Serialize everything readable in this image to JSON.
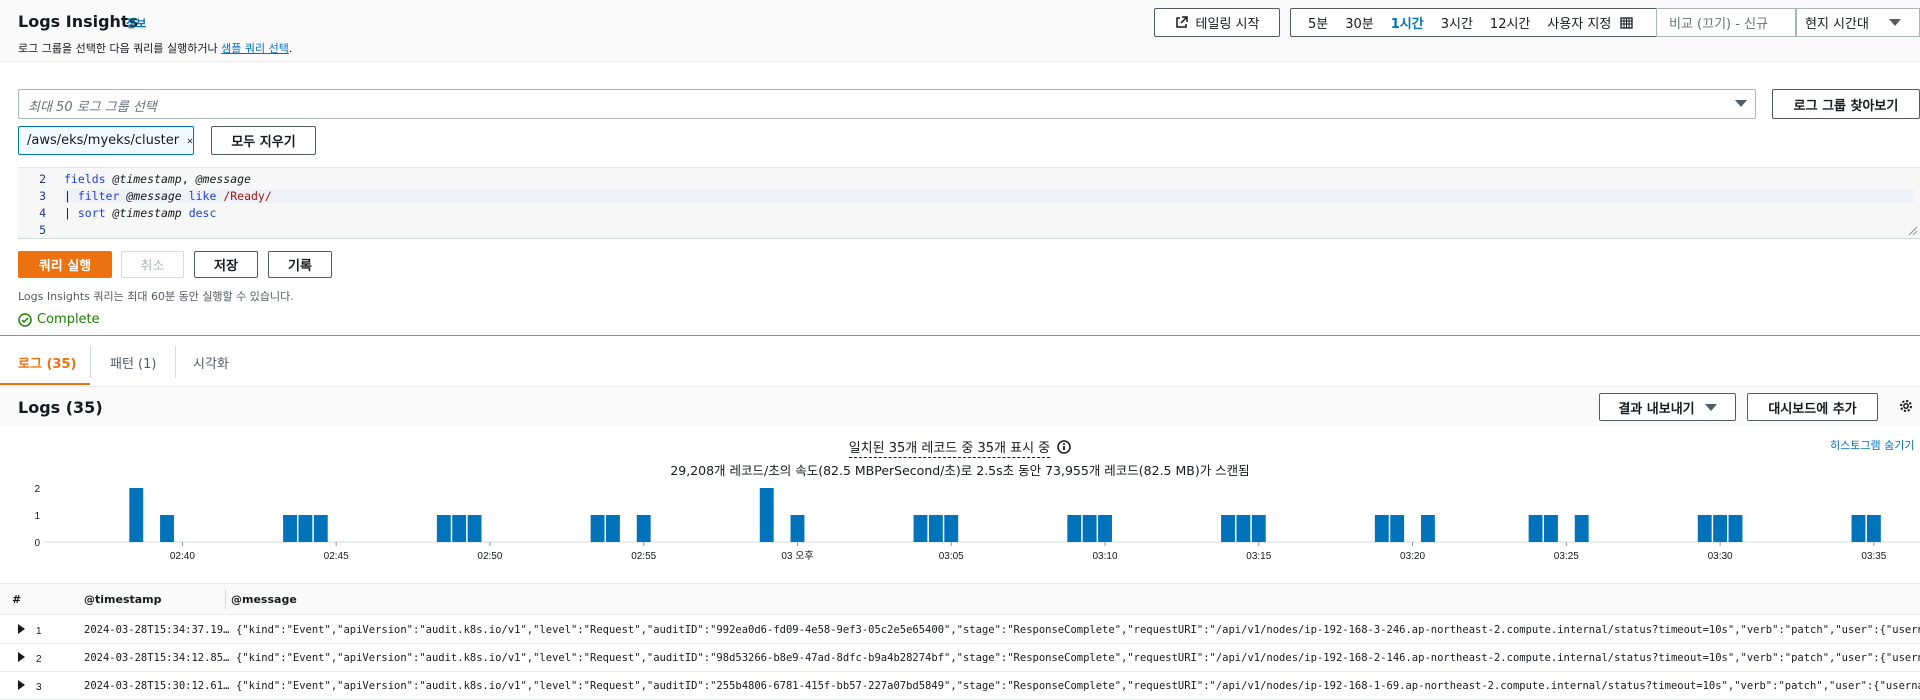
{
  "header": {
    "title": "Logs Insights",
    "info": "정보",
    "subtitle_prefix": "로그 그룹을 선택한 다음 쿼리를 실행하거나 ",
    "subtitle_link": "샘플 쿼리 선택",
    "subtitle_suffix": ".",
    "tail_button": "테일링 시작",
    "time_options": [
      "5분",
      "30분",
      "1시간",
      "3시간",
      "12시간",
      "사용자 지정"
    ],
    "selected_time": "1시간",
    "compare": "비교 (끄기) - 신규",
    "timezone": "현지 시간대"
  },
  "log_groups": {
    "placeholder": "최대 50 로그 그룹 선택",
    "browse_button": "로그 그룹 찾아보기",
    "token": "/aws/eks/myeks/cluster",
    "clear_button": "모두 지우기"
  },
  "editor": {
    "line_numbers": [
      "2",
      "3",
      "4",
      "5"
    ]
  },
  "actions": {
    "run": "쿼리 실행",
    "cancel": "취소",
    "save": "저장",
    "history": "기록",
    "note": "Logs Insights 쿼리는 최대 60분 동안 실행할 수 있습니다.",
    "status": "Complete"
  },
  "tabs": [
    "로그 (35)",
    "패턴 (1)",
    "시각화"
  ],
  "logs": {
    "title": "Logs (35)",
    "export_button": "결과 내보내기",
    "dashboard_button": "대시보드에 추가",
    "match_text": "일치된 35개 레코드 중 35개 표시 중",
    "scan_text": "29,208개 레코드/초의 속도(82.5 MBPerSecond/초)로 2.5s초 동안 73,955개 레코드(82.5 MB)가 스캔됨",
    "hide_histogram": "히스토그램 숨기기"
  },
  "chart_data": {
    "type": "bar",
    "y_ticks": [
      "0",
      "1",
      "2"
    ],
    "ylim": [
      0,
      2
    ],
    "x_ticks": [
      "02:40",
      "02:45",
      "02:50",
      "02:55",
      "03 오후",
      "03:05",
      "03:10",
      "03:15",
      "03:20",
      "03:25",
      "03:30",
      "03:35"
    ],
    "bars": [
      {
        "x": "02:38:30",
        "value": 2
      },
      {
        "x": "02:39:30",
        "value": 1
      },
      {
        "x": "02:43:30",
        "value": 1
      },
      {
        "x": "02:44:00",
        "value": 1
      },
      {
        "x": "02:44:30",
        "value": 1
      },
      {
        "x": "02:48:30",
        "value": 1
      },
      {
        "x": "02:49:00",
        "value": 1
      },
      {
        "x": "02:49:30",
        "value": 1
      },
      {
        "x": "02:53:30",
        "value": 1
      },
      {
        "x": "02:54:00",
        "value": 1
      },
      {
        "x": "02:55:00",
        "value": 1
      },
      {
        "x": "02:59:00",
        "value": 2
      },
      {
        "x": "03:00:00",
        "value": 1
      },
      {
        "x": "03:04:00",
        "value": 1
      },
      {
        "x": "03:04:30",
        "value": 1
      },
      {
        "x": "03:05:00",
        "value": 1
      },
      {
        "x": "03:09:00",
        "value": 1
      },
      {
        "x": "03:09:30",
        "value": 1
      },
      {
        "x": "03:10:00",
        "value": 1
      },
      {
        "x": "03:14:00",
        "value": 1
      },
      {
        "x": "03:14:30",
        "value": 1
      },
      {
        "x": "03:15:00",
        "value": 1
      },
      {
        "x": "03:19:00",
        "value": 1
      },
      {
        "x": "03:19:30",
        "value": 1
      },
      {
        "x": "03:20:30",
        "value": 1
      },
      {
        "x": "03:24:00",
        "value": 1
      },
      {
        "x": "03:24:30",
        "value": 1
      },
      {
        "x": "03:25:30",
        "value": 1
      },
      {
        "x": "03:29:30",
        "value": 1
      },
      {
        "x": "03:30:00",
        "value": 1
      },
      {
        "x": "03:30:30",
        "value": 1
      },
      {
        "x": "03:34:30",
        "value": 1
      },
      {
        "x": "03:35:00",
        "value": 1
      }
    ],
    "color": "#0073bb"
  },
  "table": {
    "columns": [
      "#",
      "@timestamp",
      "@message"
    ],
    "rows": [
      {
        "n": "1",
        "ts": "2024-03-28T15:34:37.19…",
        "msg": "{\"kind\":\"Event\",\"apiVersion\":\"audit.k8s.io/v1\",\"level\":\"Request\",\"auditID\":\"992ea0d6-fd09-4e58-9ef3-05c2e5e65400\",\"stage\":\"ResponseComplete\",\"requestURI\":\"/api/v1/nodes/ip-192-168-3-246.ap-northeast-2.compute.internal/status?timeout=10s\",\"verb\":\"patch\",\"user\":{\"username\":\"system:"
      },
      {
        "n": "2",
        "ts": "2024-03-28T15:34:12.85…",
        "msg": "{\"kind\":\"Event\",\"apiVersion\":\"audit.k8s.io/v1\",\"level\":\"Request\",\"auditID\":\"98d53266-b8e9-47ad-8dfc-b9a4b28274bf\",\"stage\":\"ResponseComplete\",\"requestURI\":\"/api/v1/nodes/ip-192-168-2-146.ap-northeast-2.compute.internal/status?timeout=10s\",\"verb\":\"patch\",\"user\":{\"username\":\"system:"
      },
      {
        "n": "3",
        "ts": "2024-03-28T15:30:12.61…",
        "msg": "{\"kind\":\"Event\",\"apiVersion\":\"audit.k8s.io/v1\",\"level\":\"Request\",\"auditID\":\"255b4806-6781-415f-bb57-227a07bd5849\",\"stage\":\"ResponseComplete\",\"requestURI\":\"/api/v1/nodes/ip-192-168-1-69.ap-northeast-2.compute.internal/status?timeout=10s\",\"verb\":\"patch\",\"user\":{\"username\":\"system:n"
      }
    ]
  }
}
